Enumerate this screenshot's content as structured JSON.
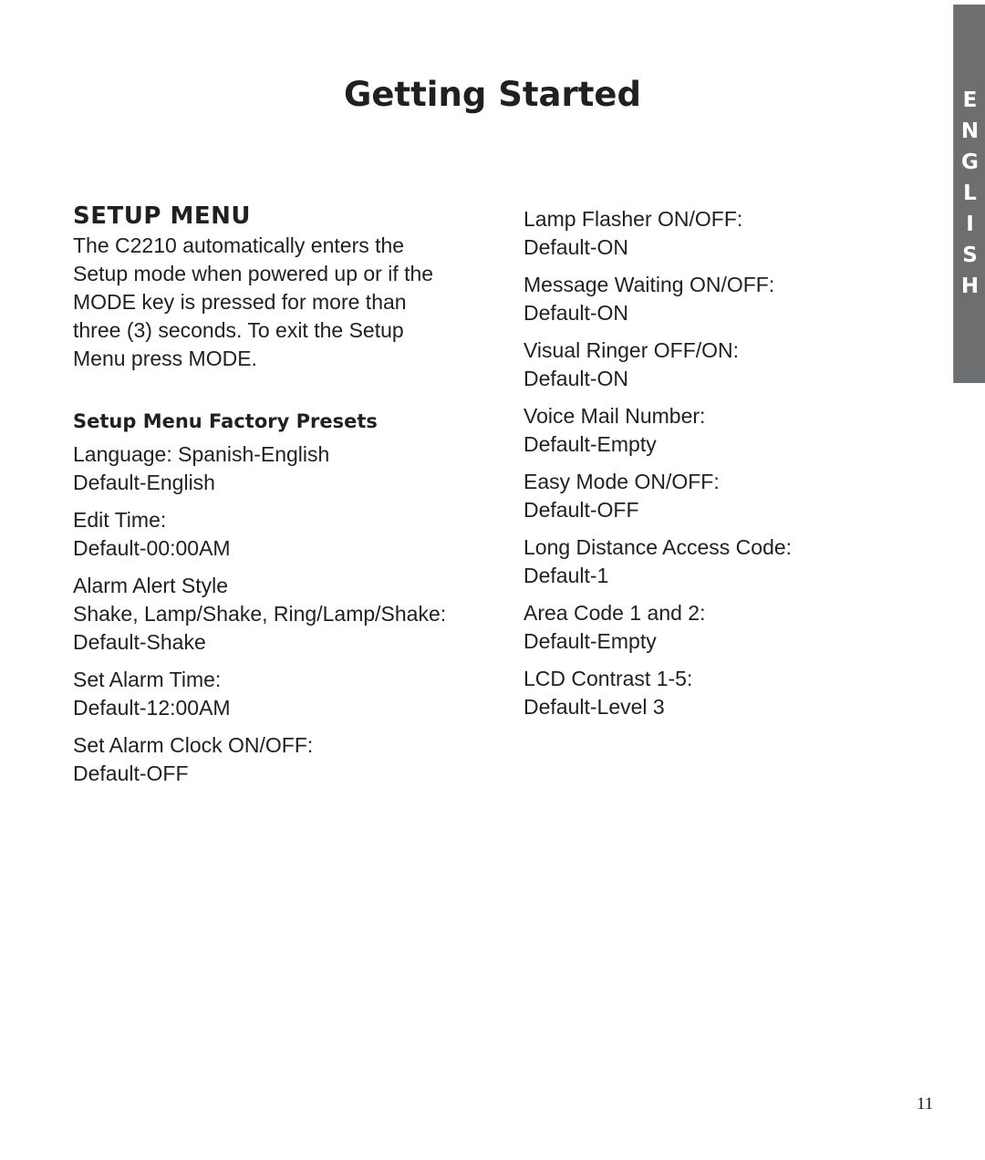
{
  "page": {
    "title": "Getting Started",
    "page_number": "11",
    "side_tab": {
      "label": "ENGLISH",
      "letters": [
        "E",
        "N",
        "G",
        "L",
        "I",
        "S",
        "H"
      ],
      "color": "#6d6e70"
    }
  },
  "setup_menu": {
    "heading": "SETUP MENU",
    "intro": [
      "The C2210 automatically enters the",
      "Setup mode when powered up or if the",
      "MODE key is pressed for more than",
      "three (3) seconds. To exit the Setup",
      "Menu press MODE."
    ],
    "presets_heading": "Setup Menu Factory Presets"
  },
  "left_presets": [
    {
      "lines": [
        "Language: Spanish-English",
        "Default-English"
      ]
    },
    {
      "lines": [
        "Edit Time:",
        "Default-00:00AM"
      ]
    },
    {
      "lines": [
        "Alarm Alert Style",
        "Shake, Lamp/Shake, Ring/Lamp/Shake:",
        "Default-Shake"
      ]
    },
    {
      "lines": [
        "Set Alarm Time:",
        "Default-12:00AM"
      ]
    },
    {
      "lines": [
        "Set Alarm Clock ON/OFF:",
        "Default-OFF"
      ]
    }
  ],
  "right_presets": [
    {
      "lines": [
        "Lamp Flasher ON/OFF:",
        "Default-ON"
      ]
    },
    {
      "lines": [
        "Message Waiting ON/OFF:",
        "Default-ON"
      ]
    },
    {
      "lines": [
        "Visual Ringer OFF/ON:",
        "Default-ON"
      ]
    },
    {
      "lines": [
        "Voice Mail Number:",
        "Default-Empty"
      ]
    },
    {
      "lines": [
        "Easy Mode ON/OFF:",
        "Default-OFF"
      ]
    },
    {
      "lines": [
        "Long Distance Access Code:",
        "Default-1"
      ]
    },
    {
      "lines": [
        "Area Code 1 and 2:",
        "Default-Empty"
      ]
    },
    {
      "lines": [
        "LCD Contrast 1-5:",
        "Default-Level 3"
      ]
    }
  ]
}
